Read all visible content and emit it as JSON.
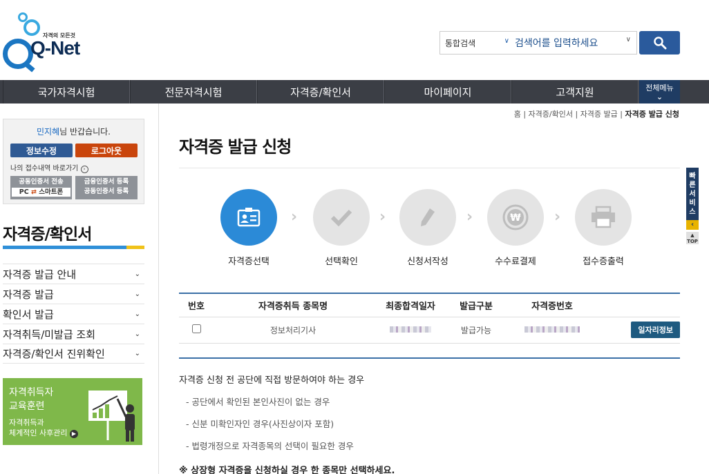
{
  "logo": {
    "tagline": "자격의 모든것",
    "name": "Q-Net"
  },
  "search": {
    "category": "통합검색",
    "placeholder": "검색어를 입력하세요"
  },
  "nav": {
    "items": [
      "국가자격시험",
      "전문자격시험",
      "자격증/확인서",
      "마이페이지",
      "고객지원"
    ],
    "all_menu": "전체메뉴"
  },
  "user": {
    "name": "민지혜",
    "greeting": "님 반갑습니다.",
    "edit_label": "정보수정",
    "logout_label": "로그아웃",
    "history_label": "나의 접수내역 바로가기",
    "cert_transfer_line1": "공동인증서 전송",
    "cert_transfer_line2a": "PC",
    "cert_transfer_line2b": "스마트폰",
    "fin_cert_line1": "금융인증서 등록",
    "fin_cert_line2": "공동인증서 등록"
  },
  "sidebar": {
    "title": "자격증/확인서",
    "items": [
      {
        "label": "자격증 발급 안내"
      },
      {
        "label": "자격증 발급"
      },
      {
        "label": "확인서 발급"
      },
      {
        "label": "자격취득/미발급 조회"
      },
      {
        "label": "자격증/확인서 진위확인"
      }
    ]
  },
  "banner": {
    "line1": "자격취득자",
    "line2": "교육훈련",
    "line3": "자격취득과",
    "line4": "체계적인 사후관리"
  },
  "breadcrumb": {
    "home": "홈",
    "c1": "자격증/확인서",
    "c2": "자격증 발급",
    "current": "자격증 발급 신청"
  },
  "page_title": "자격증 발급 신청",
  "steps": [
    {
      "label": "자격증선택",
      "icon": "id-card-icon",
      "active": true
    },
    {
      "label": "선택확인",
      "icon": "check-icon",
      "active": false
    },
    {
      "label": "신청서작성",
      "icon": "pencil-icon",
      "active": false
    },
    {
      "label": "수수료결제",
      "icon": "won-coin-icon",
      "active": false
    },
    {
      "label": "접수증출력",
      "icon": "printer-icon",
      "active": false
    }
  ],
  "table": {
    "headers": [
      "번호",
      "자격증취득 종목명",
      "최종합격일자",
      "발급구분",
      "자격증번호",
      ""
    ],
    "rows": [
      {
        "item": "정보처리기사",
        "status": "발급가능",
        "job_button": "일자리정보"
      }
    ]
  },
  "notes": {
    "heading": "자격증 신청 전 공단에 직접 방문하여야 하는 경우",
    "items": [
      "- 공단에서 확인된 본인사진이 없는 경우",
      "- 신분 미확인자인 경우(사진상이자 포함)",
      "- 법령개정으로 자격종목의 선택이 필요한 경우"
    ],
    "warning": "※ 상장형 자격증을 신청하실 경우 한 종목만 선택하세요."
  },
  "quick": {
    "label": "빠른서비스",
    "top": "TOP"
  },
  "colors": {
    "nav_bg": "#3b3e45",
    "accent_blue": "#2b8ad7",
    "logout": "#c9450c",
    "edit": "#2f5a94"
  }
}
